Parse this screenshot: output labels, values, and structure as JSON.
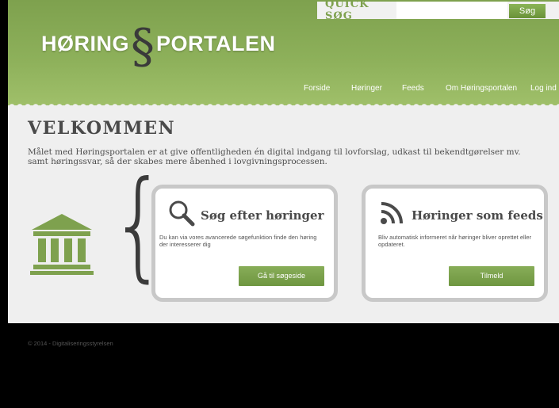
{
  "quicksearch": {
    "label": "QUICK SØG",
    "placeholder": "",
    "button": "Søg"
  },
  "logo": {
    "left": "HØRING",
    "symbol": "§",
    "right": "PORTALEN"
  },
  "nav": [
    "Forside",
    "Høringer",
    "Feeds",
    "Om Høringsportalen",
    "Log ind"
  ],
  "welcome": {
    "title": "VELKOMMEN",
    "text": "Målet med Høringsportalen er at give offentligheden én digital indgang til lovforslag, udkast til bekendtgørelser mv. samt høringssvar, så der skabes mere åbenhed i lovgivningsprocessen."
  },
  "cards": [
    {
      "title": "Søg efter høringer",
      "text": "Du kan via vores avancerede søgefunktion finde den høring der interesserer dig",
      "button": "Gå til søgeside",
      "icon": "magnifier-icon"
    },
    {
      "title": "Høringer som feeds",
      "text": "Bliv automatisk informeret når høringer bliver oprettet eller opdateret.",
      "button": "Tilmeld",
      "icon": "rss-icon"
    }
  ],
  "footer": {
    "copyright": "© 2014 - Digitaliseringsstyrelsen"
  },
  "colors": {
    "accent": "#7ea14e",
    "button": "#7aa14a",
    "text": "#4a4a4a",
    "page": "#efefef"
  }
}
